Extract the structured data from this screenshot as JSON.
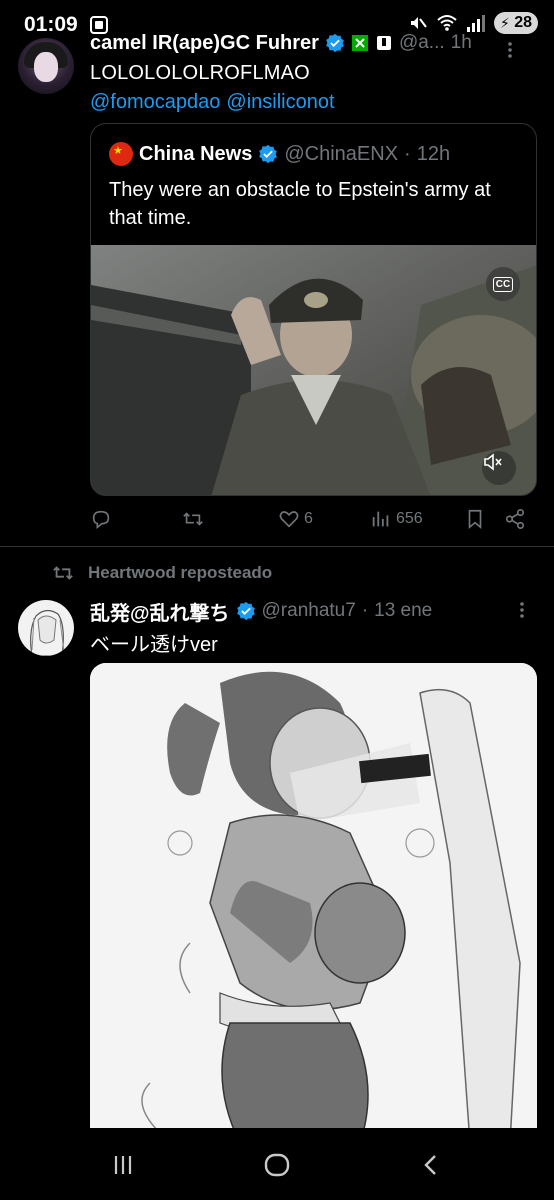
{
  "status_bar": {
    "time": "01:09",
    "battery_level": "28"
  },
  "tweet1": {
    "author_name": "camel IR(ape)GC Fuhrer",
    "author_handle": "@a...",
    "time": "1h",
    "text": "LOLOLOLOLROFLMAO",
    "mentions": [
      "@fomocapdao",
      "@insiliconot"
    ]
  },
  "quoted_tweet": {
    "author_name": "China News",
    "author_handle": "@ChinaENX",
    "separator": "·",
    "time": "12h",
    "text": "They were an obstacle to Epstein's army at that time.",
    "cc_label": "CC"
  },
  "actions": {
    "likes": "6",
    "views": "656"
  },
  "repost": {
    "label": "Heartwood reposteado"
  },
  "tweet2": {
    "author_name": "乱発@乱れ撃ち",
    "author_handle": "@ranhatu7",
    "separator": "·",
    "time": "13 ene",
    "text": "ベール透けver"
  },
  "colors": {
    "background": "#000000",
    "text_primary": "#e7e9ea",
    "text_secondary": "#71767b",
    "link": "#1d9bf0",
    "verified": "#1d9bf0",
    "divider": "#2f3336"
  },
  "icons": {
    "status_left": "screenshot-icon",
    "status_right": [
      "mute-icon",
      "wifi-icon",
      "signal-icon",
      "battery-icon"
    ],
    "quote_media": [
      "captions-icon",
      "volume-muted-icon"
    ],
    "actions": [
      "reply-icon",
      "repost-icon",
      "like-icon",
      "views-icon",
      "bookmark-icon",
      "share-icon"
    ],
    "nav": [
      "recents-icon",
      "home-icon",
      "back-icon"
    ]
  }
}
